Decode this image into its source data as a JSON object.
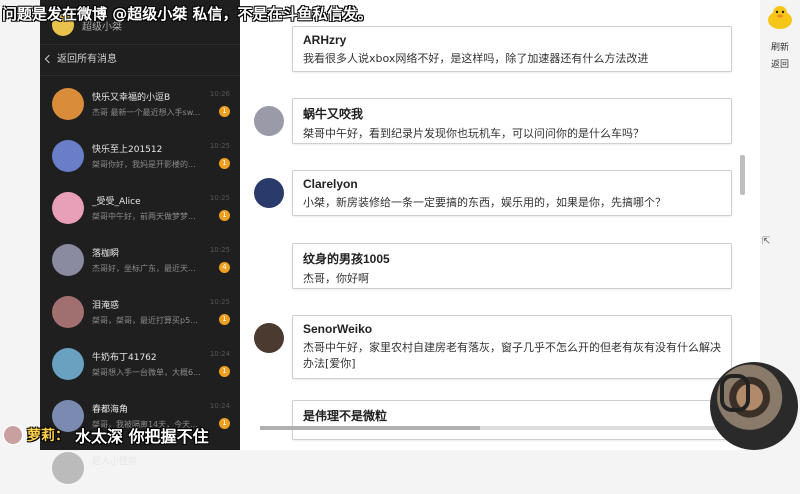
{
  "banner": "问题是发在微博 @超级小桀 私信，不是在斗鱼私信发。",
  "phone": {
    "header_name": "超级小桀",
    "back_label": "返回所有消息",
    "conversations": [
      {
        "name": "快乐又幸福的小逗B",
        "preview": "杰哥 最新一个最近想入手sw...",
        "time": "10:26",
        "badge": "1",
        "color": "#d98c3a"
      },
      {
        "name": "快乐至上201512",
        "preview": "桀哥你好，我妈是开影楼的...",
        "time": "10:25",
        "badge": "1",
        "color": "#6a7ec8"
      },
      {
        "name": "_受受_Alice",
        "preview": "桀哥中午好，前两天做梦梦...",
        "time": "10:25",
        "badge": "1",
        "color": "#e8a0b8"
      },
      {
        "name": "落枷瞬",
        "preview": "杰哥好，坐标广东，最近天...",
        "time": "10:25",
        "badge": "4",
        "color": "#8a8aa0"
      },
      {
        "name": "泪淹惑",
        "preview": "桀哥，桀哥，最近打算买p5...",
        "time": "10:25",
        "badge": "1",
        "color": "#a07070"
      },
      {
        "name": "牛奶布丁41762",
        "preview": "桀哥想入手一台微单，大概6...",
        "time": "10:24",
        "badge": "1",
        "color": "#6aa0c0"
      },
      {
        "name": "春都海角",
        "preview": "桀哥，我被隔离14天，今天...",
        "time": "10:24",
        "badge": "1",
        "color": "#7a8ab0"
      },
      {
        "name": "超人小怪兽",
        "preview": "",
        "time": "",
        "badge": "",
        "color": "#bbbbbb"
      }
    ]
  },
  "messages": [
    {
      "user": "ARHzry",
      "text": "我看很多人说xbox网络不好，是这样吗，除了加速器还有什么方法改进",
      "avatar": ""
    },
    {
      "user": "蜗牛又咬我",
      "text": "桀哥中午好，看到纪录片发现你也玩机车，可以问问你的是什么车吗？",
      "avatar": "#9a9aa8"
    },
    {
      "user": "Clarelyon",
      "text": "小桀，新房装修给一条一定要搞的东西，娱乐用的，如果是你，先搞哪个？",
      "avatar": "#2a3a6a"
    },
    {
      "user": "纹身的男孩1005",
      "text": "杰哥，你好啊",
      "avatar": ""
    },
    {
      "user": "SenorWeiko",
      "text": "杰哥中午好，家里农村自建房老有落灰，窗子几乎不怎么开的但老有灰有没有什么解决办法[爱你]",
      "avatar": "#4a3a30"
    },
    {
      "user": "是伟理不是微粒",
      "text": "",
      "avatar": ""
    }
  ],
  "right": {
    "refresh_label": "刷新",
    "return_label": "返回"
  },
  "danmaku": {
    "name": "萝莉：",
    "text": "水太深 你把握不住"
  }
}
